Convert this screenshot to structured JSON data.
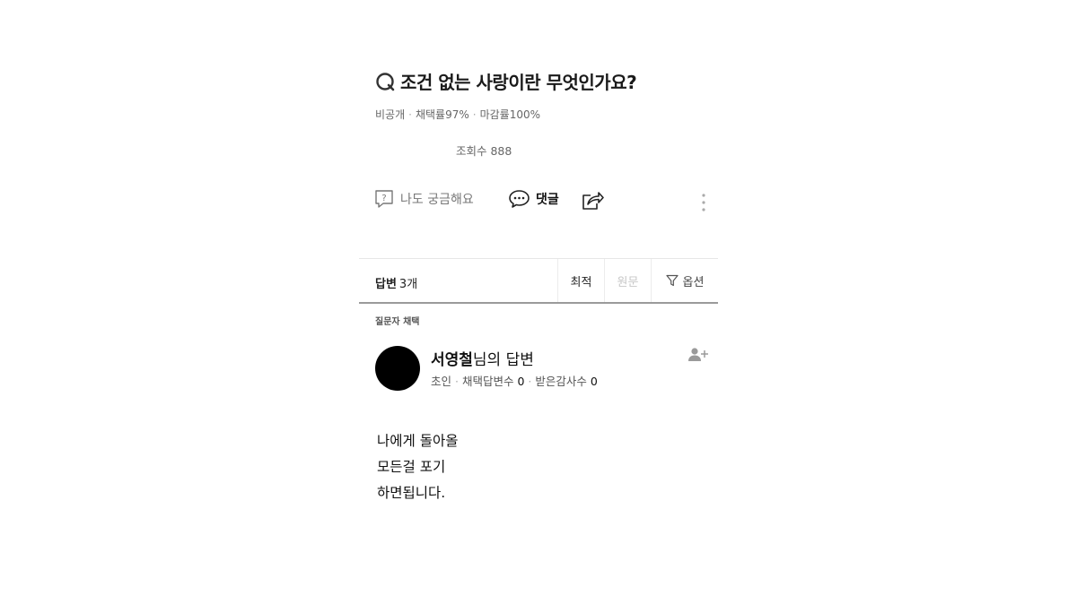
{
  "question": {
    "title": "조건 없는 사랑이란 무엇인가요?",
    "meta": {
      "visibility": "비공개",
      "adoption_rate": "채택률97%",
      "closing_rate": "마감률100%"
    },
    "views": "조회수 888"
  },
  "actions": {
    "curious_label": "나도 궁금해요",
    "comment_label": "댓글",
    "icons": [
      "question-box-icon",
      "speech-bubble-icon",
      "share-icon",
      "more-vertical-icon"
    ]
  },
  "answers_bar": {
    "label": "답변",
    "count": "3개",
    "tabs": {
      "recent": "최적",
      "original": "원문",
      "options": "옵션"
    }
  },
  "answer": {
    "chosen_label": "질문자 채택",
    "author_name": "서영철",
    "author_suffix": "님의 답변",
    "author_meta": {
      "level": "초인",
      "adopted_label": "채택답변수",
      "adopted_count": "0",
      "thanks_label": "받은감사수",
      "thanks_count": "0"
    },
    "lines": [
      "나에게 돌아올",
      "모든걸 포기",
      "하면됩니다."
    ]
  },
  "colors": {
    "text": "#111111",
    "muted": "#666666",
    "faded_tab": "#c7c7c7",
    "avatar": "#000000"
  }
}
